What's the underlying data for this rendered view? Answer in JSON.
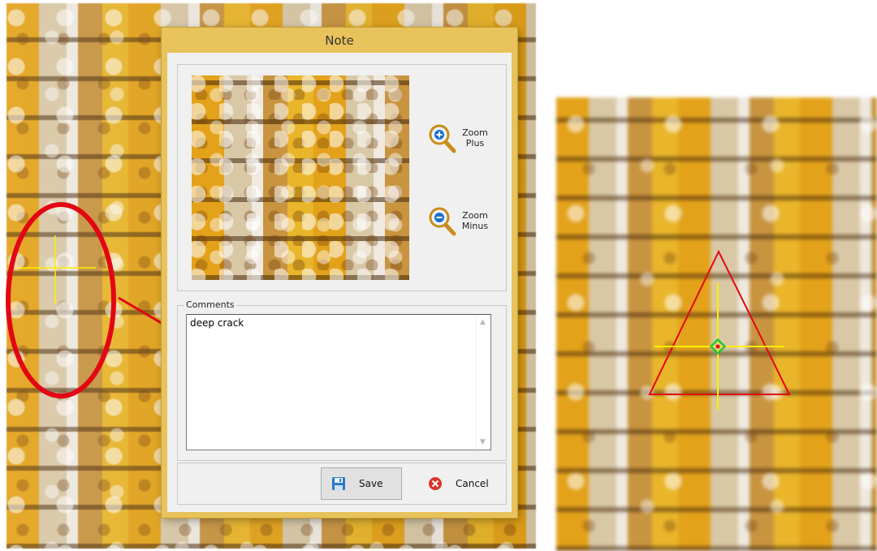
{
  "dialog": {
    "title": "Note",
    "zoom_plus": {
      "line1": "Zoom",
      "line2": "Plus",
      "icon": "zoom-plus-icon"
    },
    "zoom_minus": {
      "line1": "Zoom",
      "line2": "Minus",
      "icon": "zoom-minus-icon"
    },
    "comments": {
      "legend": "Comments",
      "value": "deep crack"
    },
    "buttons": {
      "save": {
        "label": "Save",
        "icon": "floppy-disk-icon"
      },
      "cancel": {
        "label": "Cancel",
        "icon": "red-x-circle-icon"
      }
    }
  },
  "colors": {
    "dialog_frame": "#e8c25a",
    "annotation_red": "#e30613",
    "crosshair_yellow": "#ffee00",
    "marker_green": "#27c43a"
  }
}
